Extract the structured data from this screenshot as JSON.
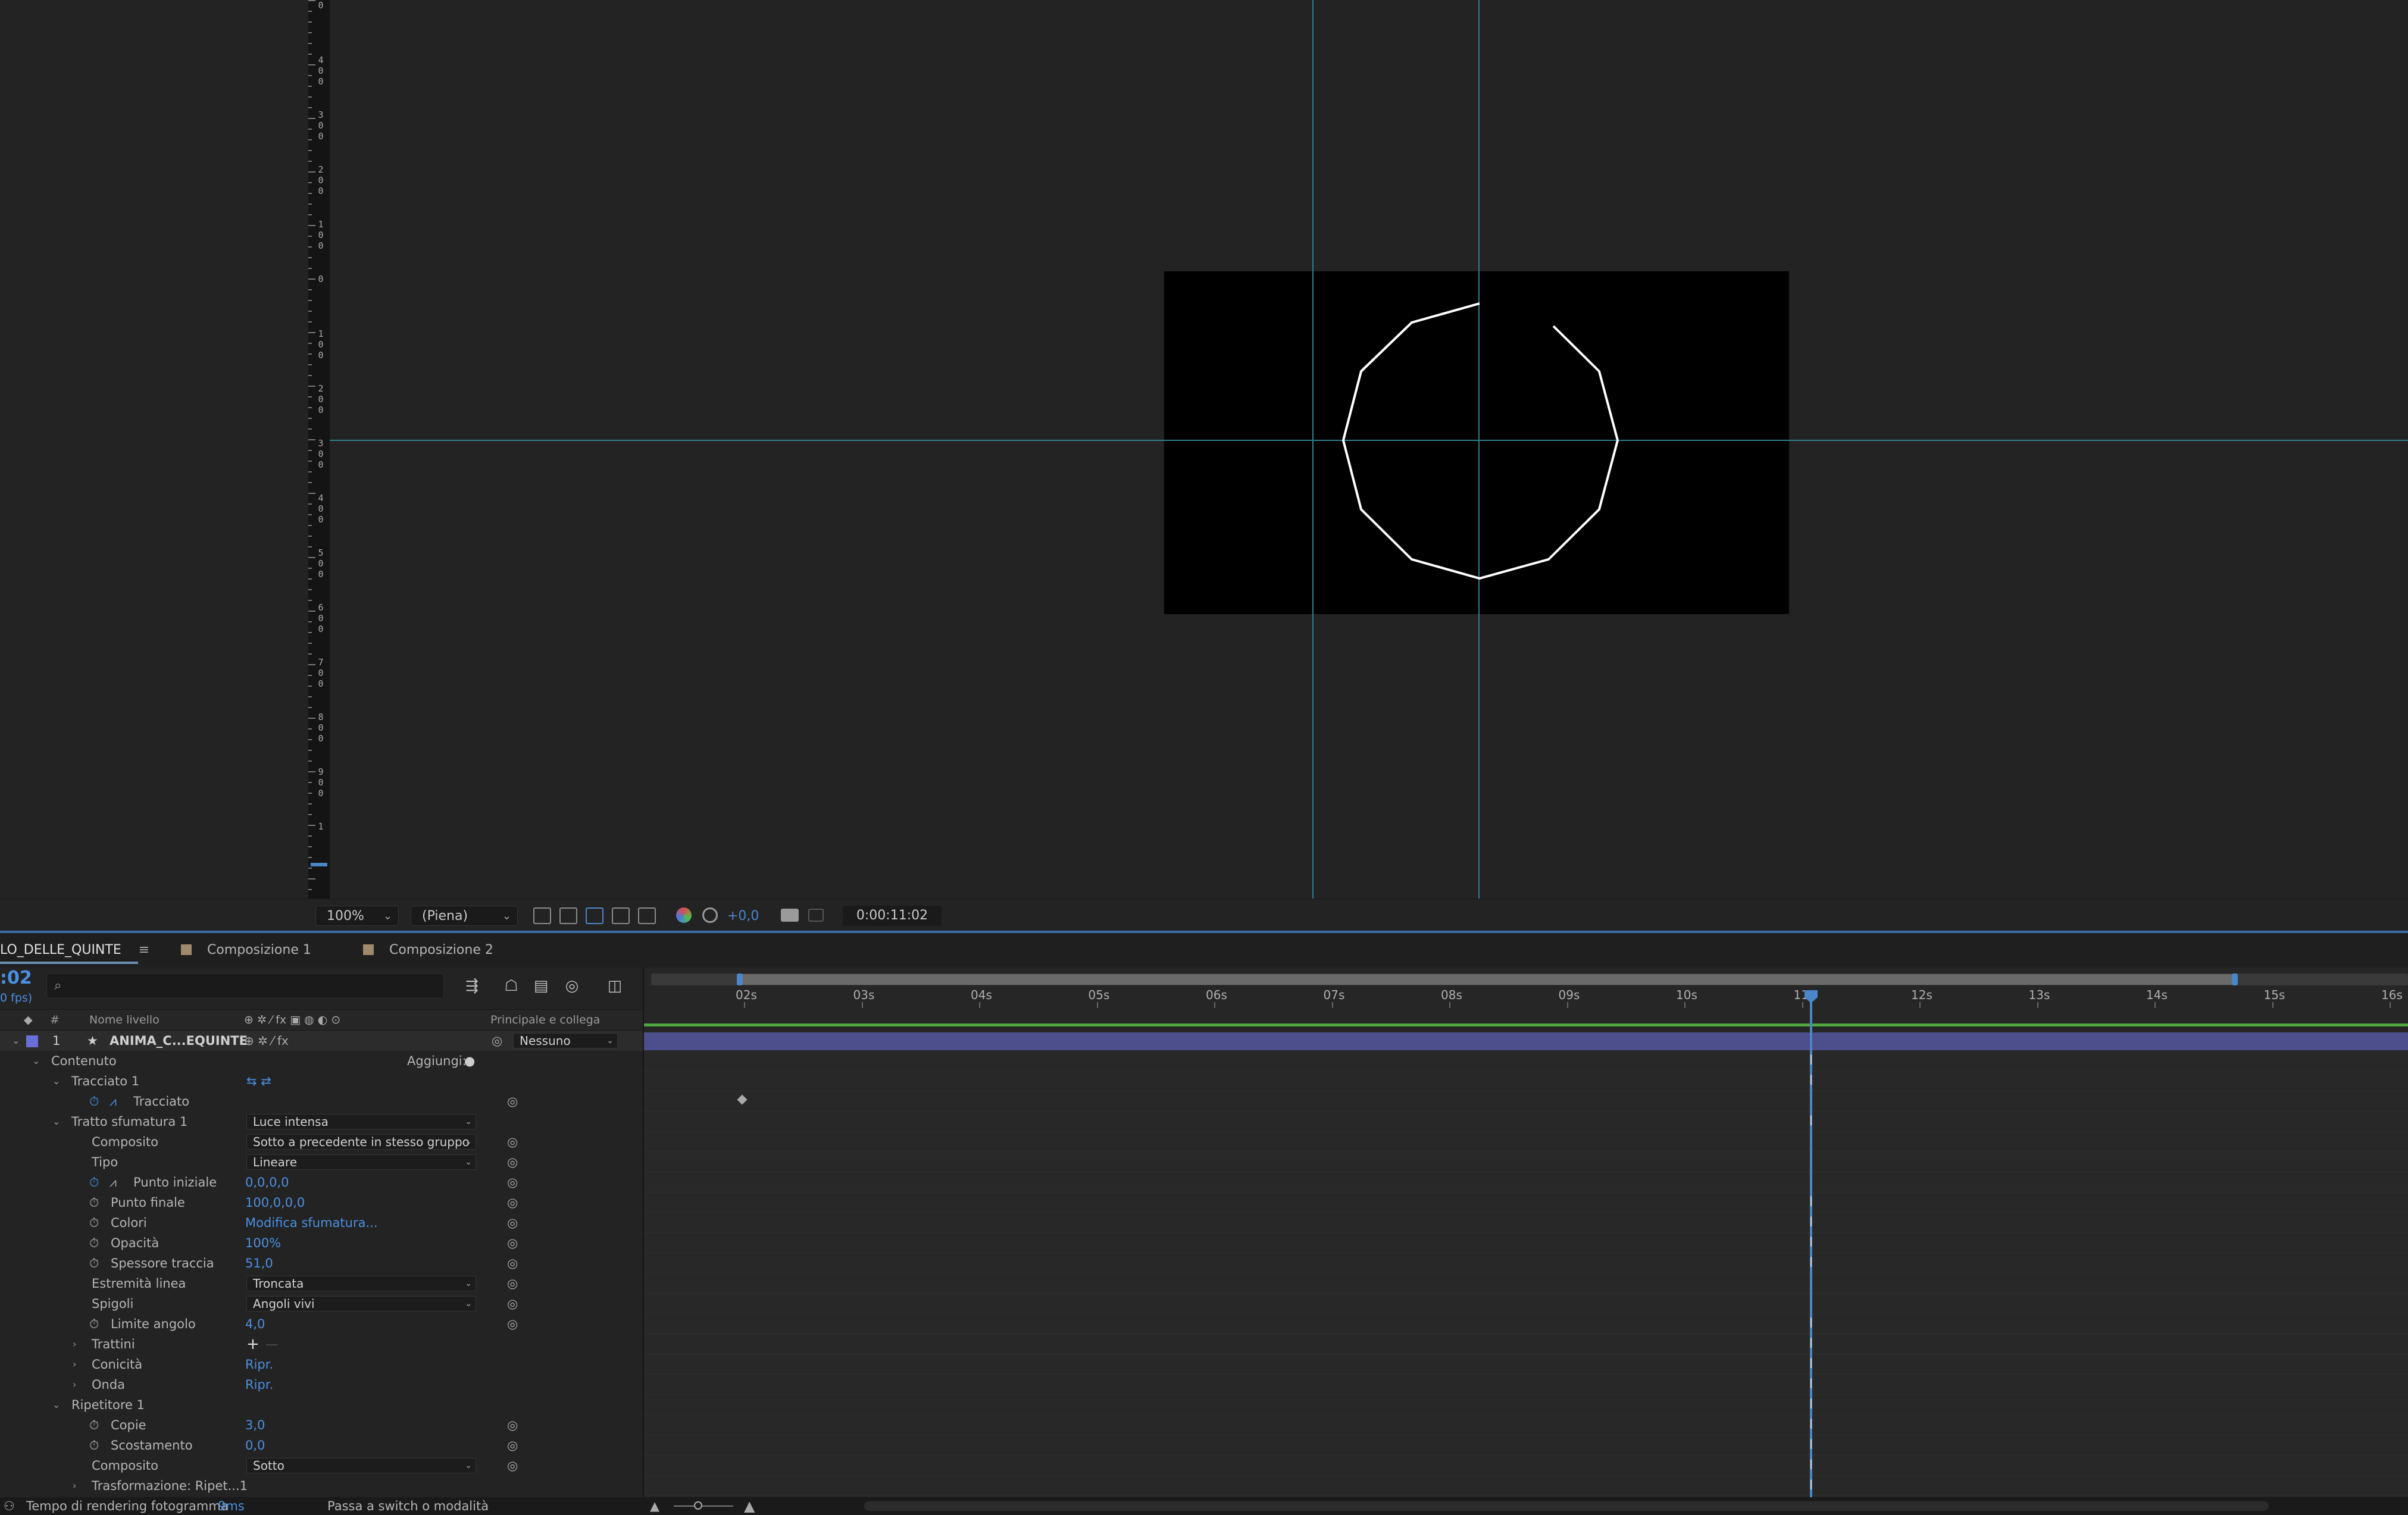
{
  "viewer": {
    "ruler_labels": [
      "0",
      "4\n0\n0",
      "3\n0\n0",
      "2\n0\n0",
      "1\n0\n0",
      "0",
      "1\n0\n0",
      "2\n0\n0",
      "3\n0\n0",
      "4\n0\n0",
      "5\n0\n0",
      "6\n0\n0",
      "7\n0\n0",
      "8\n0\n0",
      "9\n0\n0",
      "1"
    ],
    "toolbar": {
      "zoom": "100%",
      "resolution": "(Piena)",
      "exposure": "+0,0",
      "timecode": "0:00:11:02"
    }
  },
  "tabs": {
    "active": "LO_DELLE_QUINTE",
    "menu_icon": "≡",
    "items": [
      "Composizione 1",
      "Composizione 2"
    ]
  },
  "timeline": {
    "current_time": ":02",
    "fps": "0 fps)",
    "search_icon": "⌕",
    "columns": {
      "number": "#",
      "layer_name": "Nome livello",
      "parent": "Principale e collega"
    },
    "ruler": [
      "02s",
      "03s",
      "04s",
      "05s",
      "06s",
      "07s",
      "08s",
      "09s",
      "10s",
      "11s",
      "12s",
      "13s",
      "14s",
      "15s",
      "16s"
    ],
    "layer": {
      "index": "1",
      "name": "ANIMA_C...EQUINTE",
      "parent": "Nessuno"
    },
    "rows": {
      "contenuto": "Contenuto",
      "aggiungi": "Aggiungi:",
      "tracciato1": "Tracciato 1",
      "tracciato": "Tracciato",
      "tratto": "Tratto sfumatura 1",
      "tratto_mode": "Luce intensa",
      "composito": "Composito",
      "composito_val": "Sotto a precedente in stesso gruppo",
      "tipo": "Tipo",
      "tipo_val": "Lineare",
      "punto_iniziale": "Punto iniziale",
      "punto_iniziale_val": "0,0,0,0",
      "punto_finale": "Punto finale",
      "punto_finale_val": "100,0,0,0",
      "colori": "Colori",
      "colori_val": "Modifica sfumatura...",
      "opacita": "Opacità",
      "opacita_val": "100%",
      "spessore": "Spessore traccia",
      "spessore_val": "51,0",
      "estremita": "Estremità linea",
      "estremita_val": "Troncata",
      "spigoli": "Spigoli",
      "spigoli_val": "Angoli vivi",
      "limite": "Limite angolo",
      "limite_val": "4,0",
      "trattini": "Trattini",
      "conicita": "Conicità",
      "conicita_val": "Ripr.",
      "onda": "Onda",
      "onda_val": "Ripr.",
      "ripetitore": "Ripetitore 1",
      "copie": "Copie",
      "copie_val": "3,0",
      "scostamento": "Scostamento",
      "scostamento_val": "0,0",
      "composito2": "Composito",
      "composito2_val": "Sotto",
      "trasformazione": "Trasformazione: Ripet...1"
    }
  },
  "status": {
    "render_label": "Tempo di rendering fotogramma",
    "render_value": "9ms",
    "toggle": "Passa a switch o modalità"
  },
  "colors": {
    "accent": "#4a90e2",
    "layer_bar": "#4c4f8c",
    "guide": "#2f7d8c"
  }
}
